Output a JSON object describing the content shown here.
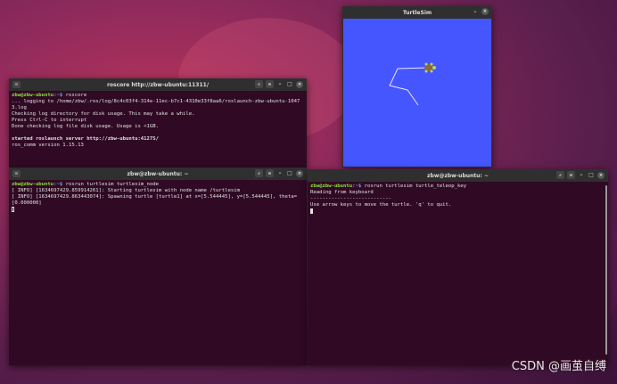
{
  "colors": {
    "terminal_bg": "#300a24",
    "turtle_bg": "#4556ff",
    "prompt_user": "#8ae234",
    "prompt_path": "#729fcf"
  },
  "prompt": {
    "user_host": "zbw@zbw-ubuntu",
    "path": ":~$"
  },
  "titlebar": {
    "menu_icon": "hamburger-icon",
    "search_icon": "search-icon",
    "minimize_icon": "–",
    "maximize_icon": "□",
    "close_icon": "×",
    "menu_glyph": "≡"
  },
  "roscore_window": {
    "title": "roscore http://zbw-ubuntu:11311/",
    "command": " roscore",
    "lines": [
      "... logging to /home/zbw/.ros/log/8c4c03f4-314e-11ec-b7c1-4310e33f8aa6/roslaunch-zbw-ubuntu-10473.log",
      "Checking log directory for disk usage. This may take a while.",
      "Press Ctrl-C to interrupt",
      "Done checking log file disk usage. Usage is <1GB."
    ],
    "server_line": "started roslaunch server http://zbw-ubuntu:41275/",
    "version_line": "ros_comm version 1.15.13"
  },
  "turtlesim_term_window": {
    "title": "zbw@zbw-ubuntu: ~",
    "command": " rosrun turtlesim turtlesim_node",
    "lines": [
      "[ INFO] [1634697429.859914261]: Starting turtlesim with node name /turtlesim",
      "[ INFO] [1634697429.863443074]: Spawning turtle [turtle1] at x=[5.544445], y=[5.544445], theta=[0.000000]"
    ]
  },
  "turtlesim_window": {
    "title": "TurtleSim"
  },
  "teleop_window": {
    "title": "zbw@zbw-ubuntu: ~",
    "command": " rosrun turtlesim turtle_teleop_key",
    "lines": [
      "Reading from keyboard",
      "---------------------------",
      "Use arrow keys to move the turtle. 'q' to quit."
    ]
  },
  "watermark": "CSDN @画茧自缚"
}
